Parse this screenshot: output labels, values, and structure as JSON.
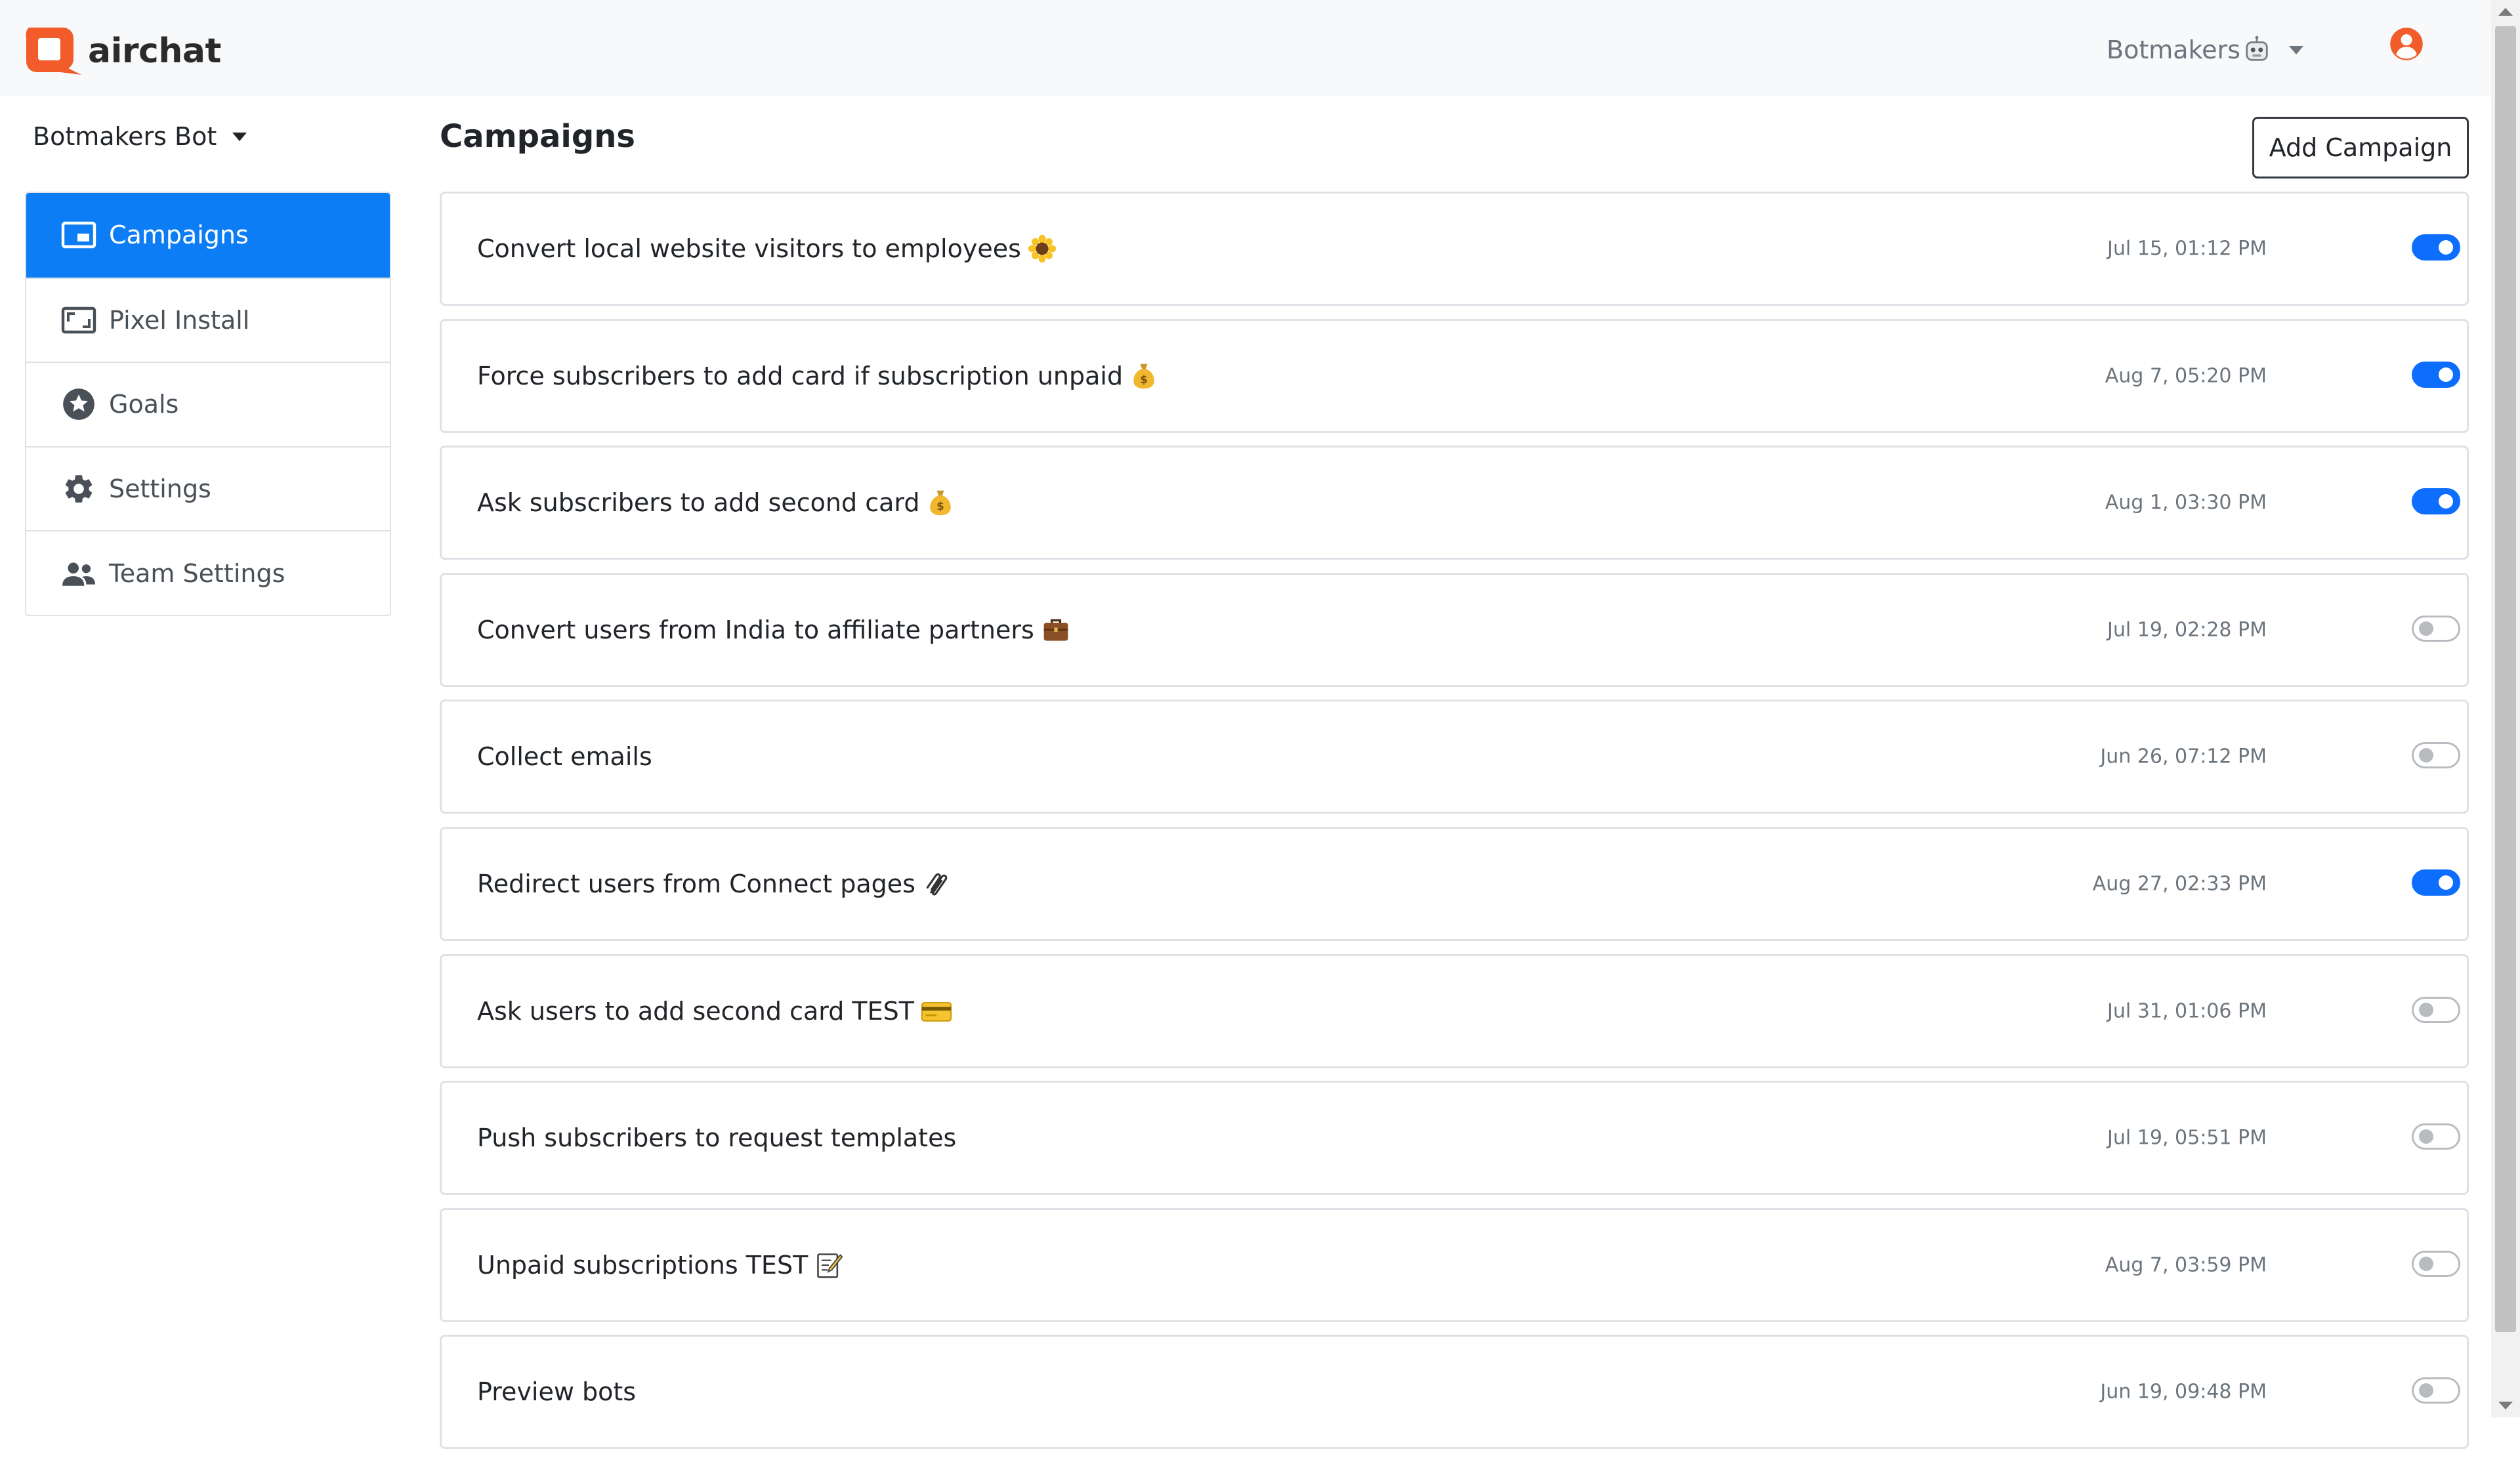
{
  "app": {
    "brand_name": "airchat",
    "brand_color": "#f25c2a",
    "workspace_name": "Botmakers",
    "workspace_icon": "robot-face-emoji",
    "user_icon": "user-circle-icon"
  },
  "sidebar": {
    "bot_selector_label": "Botmakers Bot",
    "items": [
      {
        "label": "Campaigns",
        "icon": "campaigns-icon",
        "active": true
      },
      {
        "label": "Pixel Install",
        "icon": "pixel-install-icon",
        "active": false
      },
      {
        "label": "Goals",
        "icon": "star-circle-icon",
        "active": false
      },
      {
        "label": "Settings",
        "icon": "gear-icon",
        "active": false
      },
      {
        "label": "Team Settings",
        "icon": "team-icon",
        "active": false
      }
    ]
  },
  "main": {
    "title": "Campaigns",
    "add_button_label": "Add Campaign",
    "campaigns": [
      {
        "title": "Convert local website visitors to employees",
        "emoji": "sunflower-emoji",
        "date": "Jul 15, 01:12 PM",
        "enabled": true
      },
      {
        "title": "Force subscribers to add card if subscription unpaid",
        "emoji": "money-bag-emoji",
        "date": "Aug 7, 05:20 PM",
        "enabled": true
      },
      {
        "title": "Ask subscribers to add second card",
        "emoji": "money-bag-emoji",
        "date": "Aug 1, 03:30 PM",
        "enabled": true
      },
      {
        "title": "Convert users from India to affiliate partners",
        "emoji": "briefcase-emoji",
        "date": "Jul 19, 02:28 PM",
        "enabled": false
      },
      {
        "title": "Collect emails",
        "emoji": "",
        "date": "Jun 26, 07:12 PM",
        "enabled": false
      },
      {
        "title": "Redirect users from Connect pages",
        "emoji": "paperclips-emoji",
        "date": "Aug 27, 02:33 PM",
        "enabled": true
      },
      {
        "title": "Ask users to add second card TEST",
        "emoji": "credit-card-emoji",
        "date": "Jul 31, 01:06 PM",
        "enabled": false
      },
      {
        "title": "Push subscribers to request templates",
        "emoji": "",
        "date": "Jul 19, 05:51 PM",
        "enabled": false
      },
      {
        "title": "Unpaid subscriptions TEST",
        "emoji": "memo-emoji",
        "date": "Aug 7, 03:59 PM",
        "enabled": false
      },
      {
        "title": "Preview bots",
        "emoji": "",
        "date": "Jun 19, 09:48 PM",
        "enabled": false
      }
    ]
  },
  "colors": {
    "accent": "#0d7df5",
    "toggle_on": "#0d6efd",
    "navbar_bg": "#f8f9fa",
    "muted_text": "#6c757d",
    "user_icon": "#f25c2a"
  }
}
